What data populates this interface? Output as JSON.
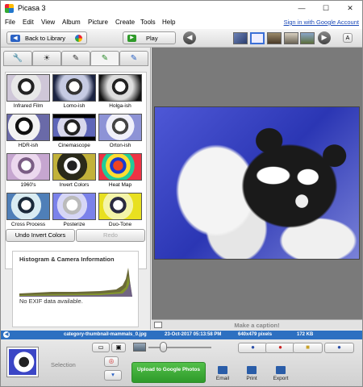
{
  "window": {
    "title": "Picasa 3",
    "minimize": "—",
    "maximize": "☐",
    "close": "✕"
  },
  "menu": {
    "items": [
      "File",
      "Edit",
      "View",
      "Album",
      "Picture",
      "Create",
      "Tools",
      "Help"
    ],
    "signin": "Sign in with Google Account"
  },
  "toolbar": {
    "back_label": "Back to Library",
    "play_label": "Play"
  },
  "effects": [
    {
      "label": "Infrared Film"
    },
    {
      "label": "Lomo-ish"
    },
    {
      "label": "Holga-ish"
    },
    {
      "label": "HDR-ish"
    },
    {
      "label": "Cinemascope"
    },
    {
      "label": "Orton-ish"
    },
    {
      "label": "1960's"
    },
    {
      "label": "Invert Colors"
    },
    {
      "label": "Heat Map"
    },
    {
      "label": "Cross Process"
    },
    {
      "label": "Posterize"
    },
    {
      "label": "Duo-Tone"
    }
  ],
  "edit": {
    "undo_label": "Undo Invert Colors",
    "redo_label": "Redo"
  },
  "histogram": {
    "title": "Histogram & Camera Information",
    "exif_text": "No EXIF data available."
  },
  "viewer": {
    "caption_placeholder": "Make a caption!"
  },
  "status": {
    "filename": "category-thumbnail-mammals_0.jpg",
    "date": "23-Oct-2017 05:13:58 PM",
    "dimensions": "640x479 pixels",
    "size": "172 KB"
  },
  "tray": {
    "selection_label": "Selection",
    "upload_label": "Upload to Google Photos",
    "email_label": "Email",
    "print_label": "Print",
    "export_label": "Export"
  },
  "colors": {
    "status_bar": "#2d70c1",
    "upload_button": "#3aa535",
    "viewer_bg": "#7a7a7a"
  }
}
